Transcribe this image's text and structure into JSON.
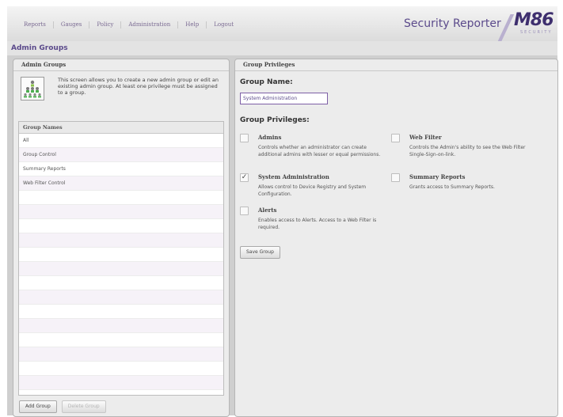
{
  "header": {
    "nav": [
      "Reports",
      "Gauges",
      "Policy",
      "Administration",
      "Help",
      "Logout"
    ],
    "brand": "Security Reporter",
    "logo_text": "M86",
    "logo_subtext": "SECURITY"
  },
  "page": {
    "title": "Admin Groups"
  },
  "left_panel": {
    "title": "Admin Groups",
    "intro_text": "This screen allows you to create a new admin group or edit an existing admin group. At least one privilege must be assigned to a group.",
    "list_header": "Group Names",
    "groups": [
      "All",
      "Group Control",
      "Summary Reports",
      "Web Filter Control"
    ],
    "add_button": "Add Group",
    "delete_button": "Delete Group"
  },
  "right_panel": {
    "title": "Group Privileges",
    "group_name_label": "Group Name:",
    "group_name_value": "System Administration",
    "privileges_label": "Group Privileges:",
    "privileges": [
      {
        "label": "Admins",
        "checked": false,
        "description": "Controls whether an administrator can create additional admins with lesser or equal permissions."
      },
      {
        "label": "System Administration",
        "checked": true,
        "description": "Allows control to Device Registry and System Configuration."
      },
      {
        "label": "Alerts",
        "checked": false,
        "description": "Enables access to Alerts. Access to a Web Filter is required."
      },
      {
        "label": "Web Filter",
        "checked": false,
        "description": "Controls the Admin's ability to see the Web Filter Single-Sign-on-link."
      },
      {
        "label": "Summary Reports",
        "checked": false,
        "description": "Grants access to Summary Reports."
      }
    ],
    "save_button": "Save Group"
  },
  "colors": {
    "accent": "#5b4a8b",
    "input_border": "#7d5fa6"
  }
}
